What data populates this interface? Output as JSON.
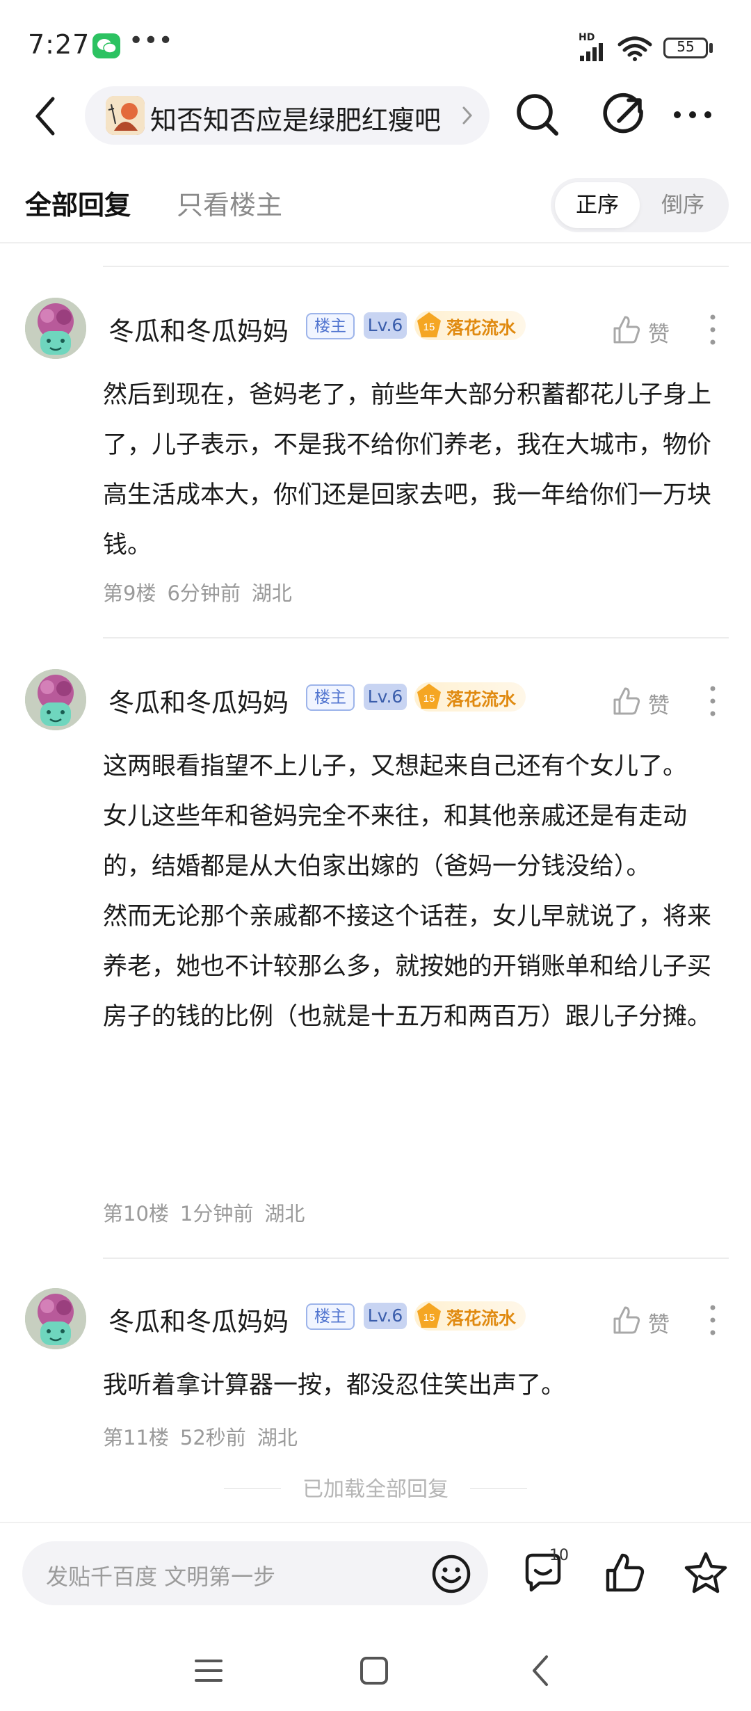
{
  "status_bar": {
    "time": "7:27",
    "dots": "•••",
    "network": "HD",
    "battery": "55"
  },
  "top_nav": {
    "forum_name": "知否知否应是绿肥红瘦吧"
  },
  "tabs": {
    "all_replies": "全部回复",
    "only_op": "只看楼主",
    "order_asc": "正序",
    "order_desc": "倒序"
  },
  "posts": [
    {
      "user": "冬瓜和冬瓜妈妈",
      "op_badge": "楼主",
      "level": "Lv.6",
      "title_level": "15",
      "title": "落花流水",
      "like_label": "赞",
      "paragraphs": [
        "然后到现在，爸妈老了，前些年大部分积蓄都花儿子身上了，儿子表示，不是我不给你们养老，我在大城市，物价高生活成本大，你们还是回家去吧，我一年给你们一万块钱。"
      ],
      "floor": "第9楼",
      "time": "6分钟前",
      "location": "湖北"
    },
    {
      "user": "冬瓜和冬瓜妈妈",
      "op_badge": "楼主",
      "level": "Lv.6",
      "title_level": "15",
      "title": "落花流水",
      "like_label": "赞",
      "paragraphs": [
        "这两眼看指望不上儿子，又想起来自己还有个女儿了。",
        "女儿这些年和爸妈完全不来往，和其他亲戚还是有走动的，结婚都是从大伯家出嫁的（爸妈一分钱没给）。",
        "然而无论那个亲戚都不接这个话茬，女儿早就说了，将来养老，她也不计较那么多，就按她的开销账单和给儿子买房子的钱的比例（也就是十五万和两百万）跟儿子分摊。"
      ],
      "floor": "第10楼",
      "time": "1分钟前",
      "location": "湖北"
    },
    {
      "user": "冬瓜和冬瓜妈妈",
      "op_badge": "楼主",
      "level": "Lv.6",
      "title_level": "15",
      "title": "落花流水",
      "like_label": "赞",
      "paragraphs": [
        "我听着拿计算器一按，都没忍住笑出声了。"
      ],
      "floor": "第11楼",
      "time": "52秒前",
      "location": "湖北"
    }
  ],
  "footer": {
    "loaded_all": "已加载全部回复"
  },
  "bottom_bar": {
    "input_placeholder": "发贴千百度 文明第一步",
    "comment_count": "10"
  },
  "colors": {
    "badge_op": "#4f73cf",
    "badge_level_bg": "#c8d4f2",
    "title_badge": "#e08a10"
  }
}
